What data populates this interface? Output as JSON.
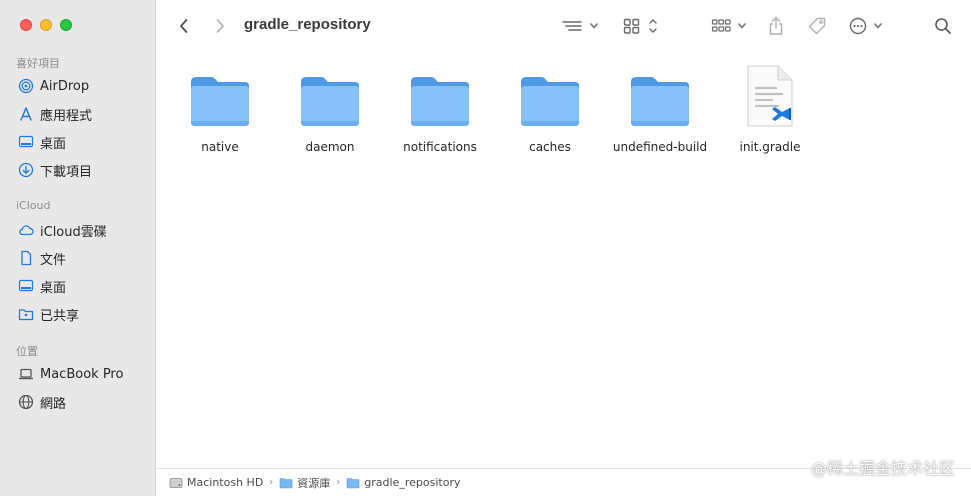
{
  "window": {
    "title": "gradle_repository"
  },
  "sidebar": {
    "favorites_title": "喜好項目",
    "favorites": [
      {
        "label": "AirDrop",
        "icon": "airdrop-icon"
      },
      {
        "label": "應用程式",
        "icon": "applications-icon"
      },
      {
        "label": "桌面",
        "icon": "desktop-icon"
      },
      {
        "label": "下載項目",
        "icon": "downloads-icon"
      }
    ],
    "icloud_title": "iCloud",
    "icloud": [
      {
        "label": "iCloud雲碟",
        "icon": "icloud-icon"
      },
      {
        "label": "文件",
        "icon": "document-icon"
      },
      {
        "label": "桌面",
        "icon": "desktop-icon"
      },
      {
        "label": "已共享",
        "icon": "shared-folder-icon"
      }
    ],
    "locations_title": "位置",
    "locations": [
      {
        "label": "MacBook Pro",
        "icon": "laptop-icon"
      },
      {
        "label": "網路",
        "icon": "network-icon"
      }
    ]
  },
  "items": [
    {
      "label": "native",
      "type": "folder"
    },
    {
      "label": "daemon",
      "type": "folder"
    },
    {
      "label": "notifications",
      "type": "folder"
    },
    {
      "label": "caches",
      "type": "folder"
    },
    {
      "label": "undefined-build",
      "type": "folder"
    },
    {
      "label": "init.gradle",
      "type": "file"
    }
  ],
  "pathbar": {
    "crumbs": [
      "Macintosh HD",
      "資源庫",
      "gradle_repository"
    ]
  },
  "watermark": "@稀土掘金技术社区",
  "colors": {
    "folder": "#6cb0f0",
    "sidebar_bg": "#e9e8e9",
    "accent": "#1f7ae0"
  }
}
